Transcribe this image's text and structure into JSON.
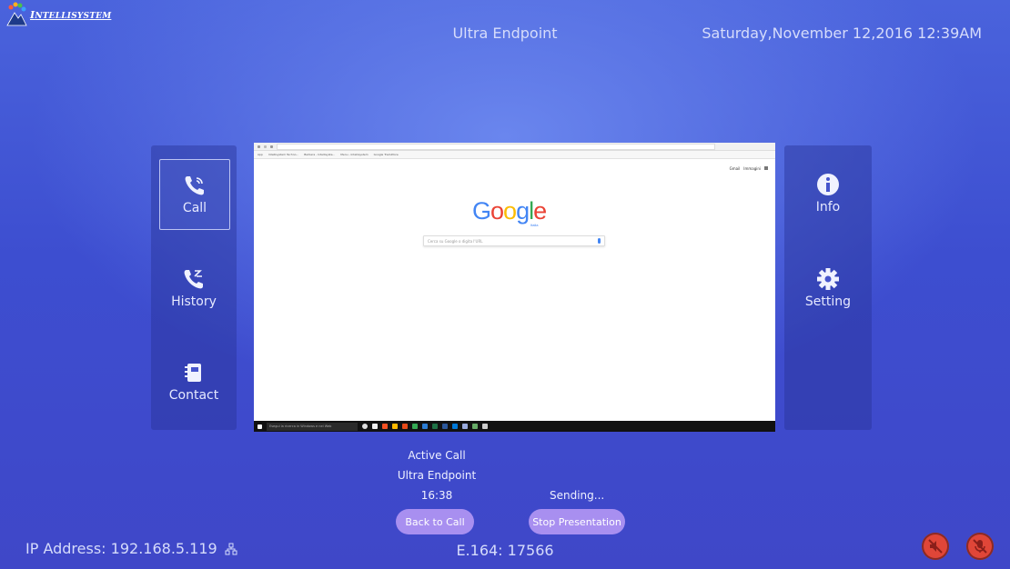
{
  "header": {
    "logo_text_first": "I",
    "logo_text_rest": "NTELLISYSTEM",
    "app_title": "Ultra Endpoint",
    "datetime": "Saturday,November 12,2016 12:39AM"
  },
  "left_nav": [
    {
      "label": "Call",
      "icon": "phone-wave-icon",
      "active": true
    },
    {
      "label": "History",
      "icon": "phone-history-icon",
      "active": false
    },
    {
      "label": "Contact",
      "icon": "contact-book-icon",
      "active": false
    }
  ],
  "right_nav": [
    {
      "label": "Info",
      "icon": "info-icon"
    },
    {
      "label": "Setting",
      "icon": "gear-icon"
    }
  ],
  "presentation": {
    "bookmarks": [
      "App",
      "Intellisystem Techno...",
      "Barbara - Intellisyste...",
      "Menu - Intellisystem",
      "Google Traduttore"
    ],
    "top_links": [
      "Gmail",
      "Immagini"
    ],
    "google_sub": "Italia",
    "search_placeholder": "Cerca su Google o digita l'URL",
    "taskbar_search": "Esegui la ricerca in Windows e nel Web"
  },
  "call": {
    "status": "Active Call",
    "name": "Ultra Endpoint",
    "duration": "16:38",
    "sending": "Sending...",
    "back_to_call": "Back to Call",
    "stop_presentation": "Stop Presentation"
  },
  "footer": {
    "ip_address": "IP Address: 192.168.5.119",
    "e164": "E.164: 17566"
  },
  "colors": {
    "accent_pill": "#a88ff0",
    "muted_indicator": "#e04638"
  }
}
